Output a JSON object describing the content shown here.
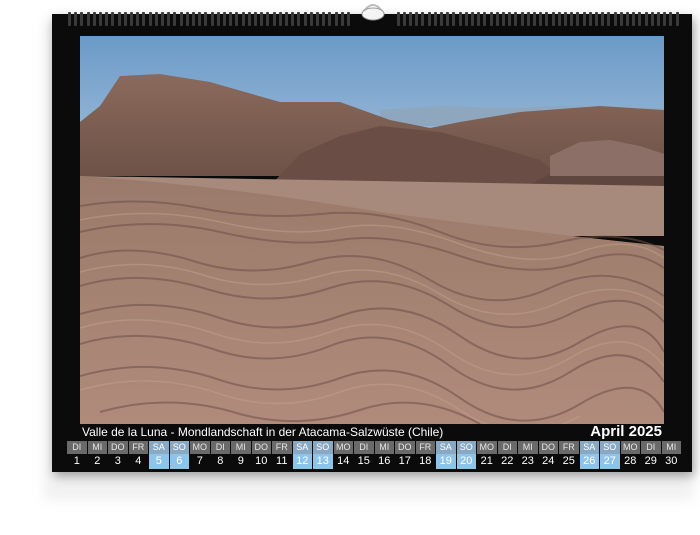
{
  "caption": "Valle de la Luna - Mondlandschaft in der Atacama-Salzwüste (Chile)",
  "month_label": "April 2025",
  "photo_subject": "desert-sand-dunes-landscape",
  "colors": {
    "background": "#0b0b0b",
    "weekday_header": "#6a6a6a",
    "weekend_highlight": "#8fc3e8"
  },
  "days": [
    {
      "weekday": "DI",
      "date": "1",
      "weekend": false
    },
    {
      "weekday": "MI",
      "date": "2",
      "weekend": false
    },
    {
      "weekday": "DO",
      "date": "3",
      "weekend": false
    },
    {
      "weekday": "FR",
      "date": "4",
      "weekend": false
    },
    {
      "weekday": "SA",
      "date": "5",
      "weekend": true
    },
    {
      "weekday": "SO",
      "date": "6",
      "weekend": true
    },
    {
      "weekday": "MO",
      "date": "7",
      "weekend": false
    },
    {
      "weekday": "DI",
      "date": "8",
      "weekend": false
    },
    {
      "weekday": "MI",
      "date": "9",
      "weekend": false
    },
    {
      "weekday": "DO",
      "date": "10",
      "weekend": false
    },
    {
      "weekday": "FR",
      "date": "11",
      "weekend": false
    },
    {
      "weekday": "SA",
      "date": "12",
      "weekend": true
    },
    {
      "weekday": "SO",
      "date": "13",
      "weekend": true
    },
    {
      "weekday": "MO",
      "date": "14",
      "weekend": false
    },
    {
      "weekday": "DI",
      "date": "15",
      "weekend": false
    },
    {
      "weekday": "MI",
      "date": "16",
      "weekend": false
    },
    {
      "weekday": "DO",
      "date": "17",
      "weekend": false
    },
    {
      "weekday": "FR",
      "date": "18",
      "weekend": false
    },
    {
      "weekday": "SA",
      "date": "19",
      "weekend": true
    },
    {
      "weekday": "SO",
      "date": "20",
      "weekend": true
    },
    {
      "weekday": "MO",
      "date": "21",
      "weekend": false
    },
    {
      "weekday": "DI",
      "date": "22",
      "weekend": false
    },
    {
      "weekday": "MI",
      "date": "23",
      "weekend": false
    },
    {
      "weekday": "DO",
      "date": "24",
      "weekend": false
    },
    {
      "weekday": "FR",
      "date": "25",
      "weekend": false
    },
    {
      "weekday": "SA",
      "date": "26",
      "weekend": true
    },
    {
      "weekday": "SO",
      "date": "27",
      "weekend": true
    },
    {
      "weekday": "MO",
      "date": "28",
      "weekend": false
    },
    {
      "weekday": "DI",
      "date": "29",
      "weekend": false
    },
    {
      "weekday": "MI",
      "date": "30",
      "weekend": false
    }
  ]
}
